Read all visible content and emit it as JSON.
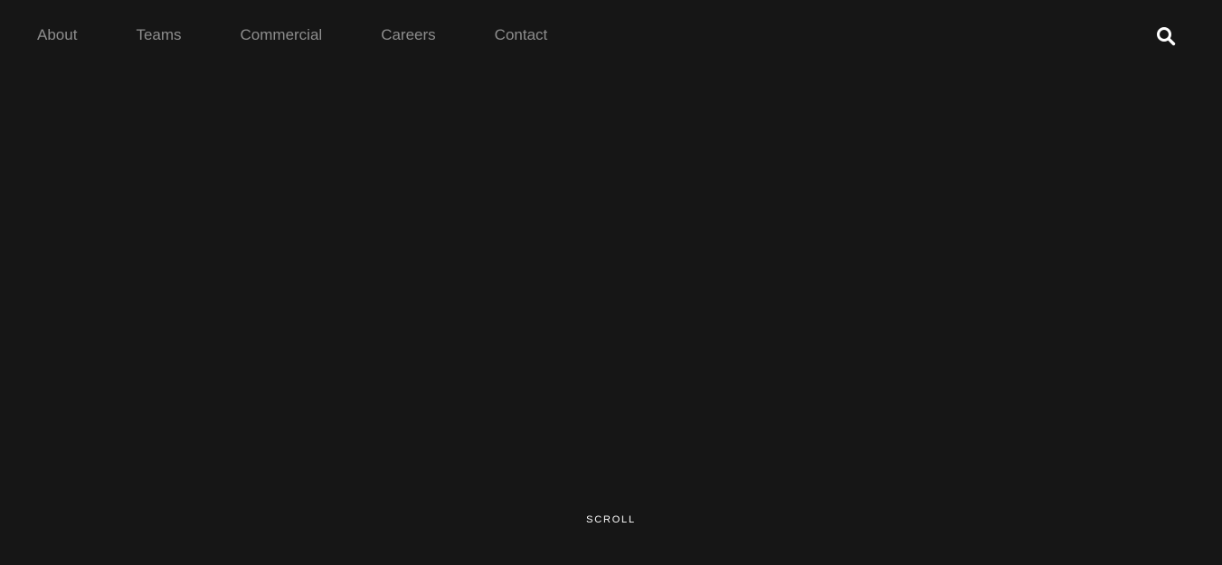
{
  "theme": {
    "background": "#161616",
    "nav_text": "#8d8d8d",
    "accent": "#ffffff"
  },
  "nav": {
    "items": [
      {
        "label": "About"
      },
      {
        "label": "Teams"
      },
      {
        "label": "Commercial"
      },
      {
        "label": "Careers"
      },
      {
        "label": "Contact"
      }
    ],
    "search_icon": "search-icon"
  },
  "hero": {
    "scroll_label": "SCROLL"
  }
}
